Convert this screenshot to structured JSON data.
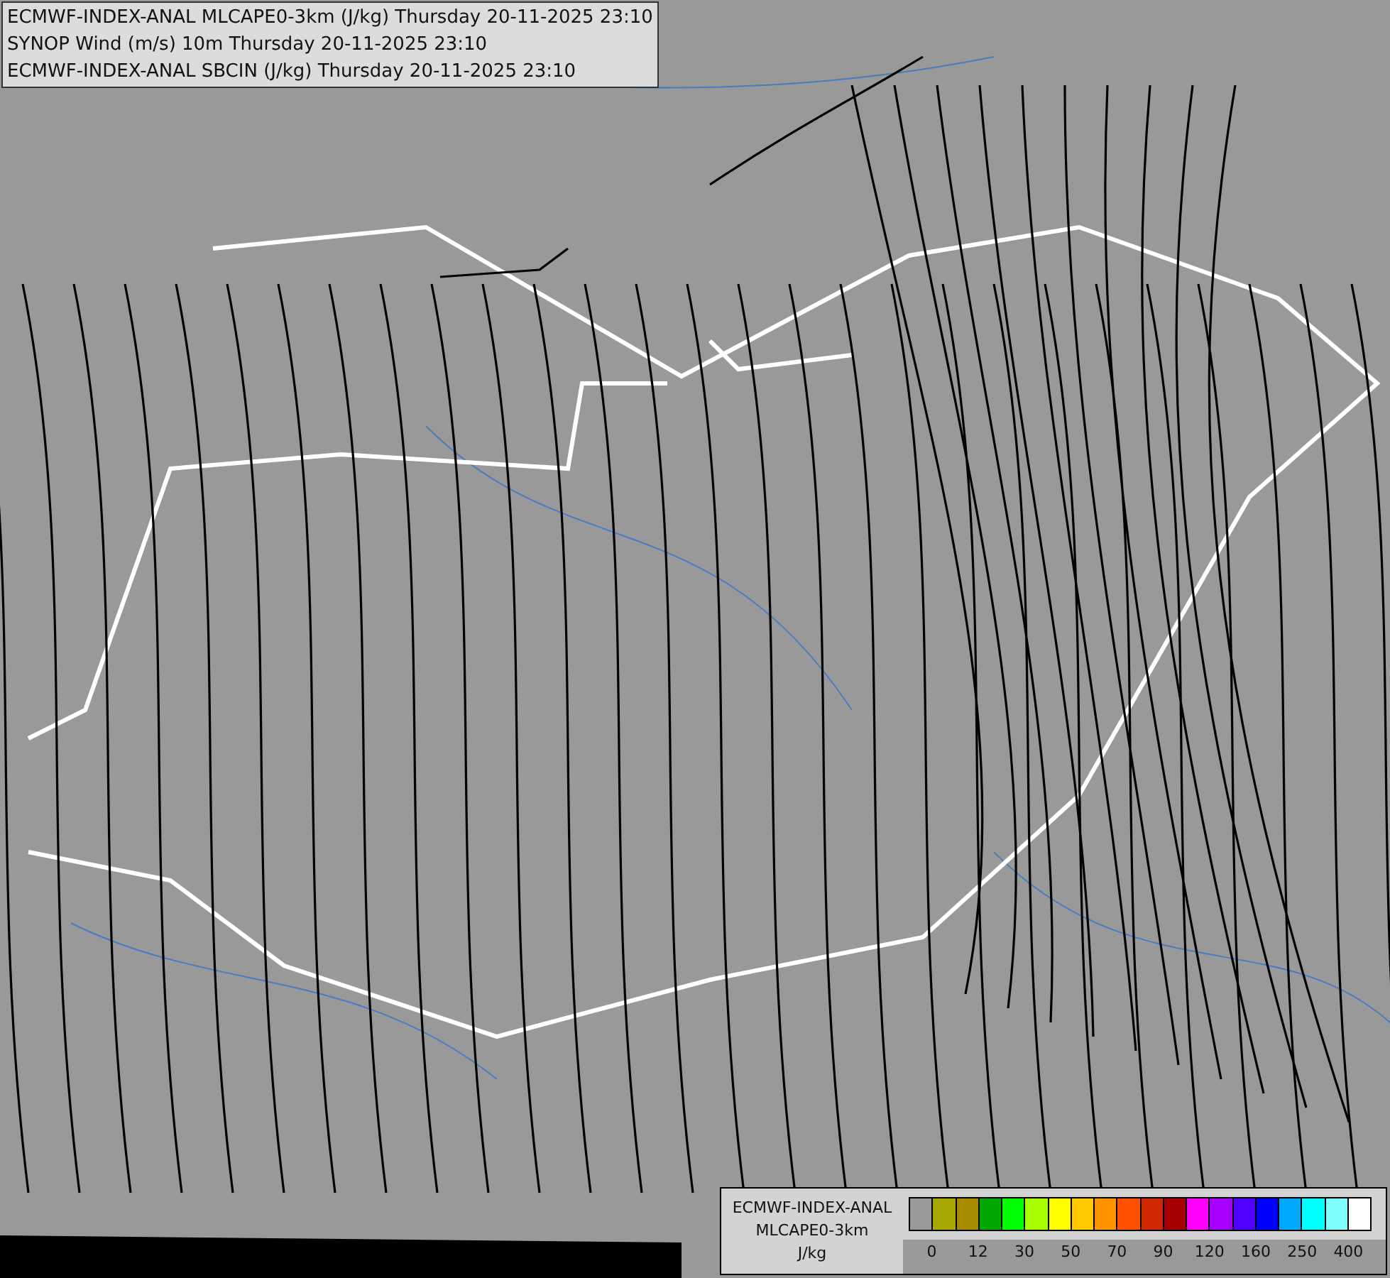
{
  "titles": [
    "ECMWF-INDEX-ANAL MLCAPE0-3km (J/kg) Thursday 20-11-2025 23:10",
    "SYNOP Wind (m/s) 10m Thursday 20-11-2025 23:10",
    "ECMWF-INDEX-ANAL SBCIN (J/kg) Thursday 20-11-2025 23:10"
  ],
  "legend": {
    "lines": [
      "ECMWF-INDEX-ANAL",
      "MLCAPE0-3km",
      "J/kg"
    ],
    "swatches": [
      {
        "color": "#999999"
      },
      {
        "color": "#a8a800"
      },
      {
        "color": "#a88c00"
      },
      {
        "color": "#00a800"
      },
      {
        "color": "#00ff00"
      },
      {
        "color": "#a8ff00"
      },
      {
        "color": "#ffff00"
      },
      {
        "color": "#ffc800"
      },
      {
        "color": "#ff9400"
      },
      {
        "color": "#ff5000"
      },
      {
        "color": "#d02800"
      },
      {
        "color": "#a80000"
      },
      {
        "color": "#ff00ff"
      },
      {
        "color": "#a800ff"
      },
      {
        "color": "#5000ff"
      },
      {
        "color": "#0000ff"
      },
      {
        "color": "#00a8ff"
      },
      {
        "color": "#00ffff"
      },
      {
        "color": "#80ffff"
      },
      {
        "color": "#ffffff"
      }
    ],
    "ticks": [
      "0",
      "12",
      "30",
      "50",
      "70",
      "90",
      "120",
      "160",
      "250",
      "400"
    ]
  }
}
